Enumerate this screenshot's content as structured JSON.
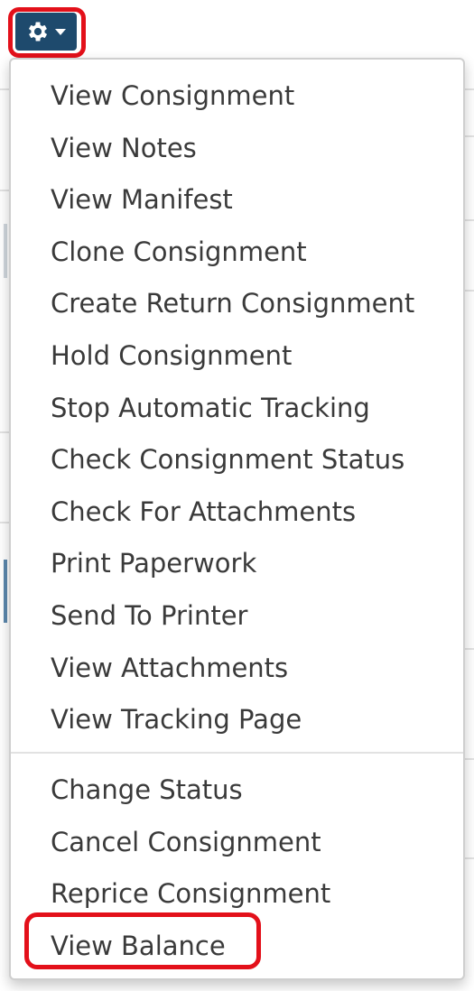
{
  "toolbar": {
    "gear_button_icon": "gear-icon",
    "caret_icon": "caret-down-icon"
  },
  "colors": {
    "button_bg": "#1e4a6d",
    "highlight": "#e3101a",
    "menu_text": "#3a3a3a"
  },
  "menu": {
    "group1": [
      {
        "label": "View Consignment"
      },
      {
        "label": "View Notes"
      },
      {
        "label": "View Manifest"
      },
      {
        "label": "Clone Consignment"
      },
      {
        "label": "Create Return Consignment"
      },
      {
        "label": "Hold Consignment"
      },
      {
        "label": "Stop Automatic Tracking"
      },
      {
        "label": "Check Consignment Status"
      },
      {
        "label": "Check For Attachments"
      },
      {
        "label": "Print Paperwork"
      },
      {
        "label": "Send To Printer"
      },
      {
        "label": "View Attachments"
      },
      {
        "label": "View Tracking Page"
      }
    ],
    "group2": [
      {
        "label": "Change Status"
      },
      {
        "label": "Cancel Consignment"
      },
      {
        "label": "Reprice Consignment"
      },
      {
        "label": "View Balance"
      }
    ]
  }
}
